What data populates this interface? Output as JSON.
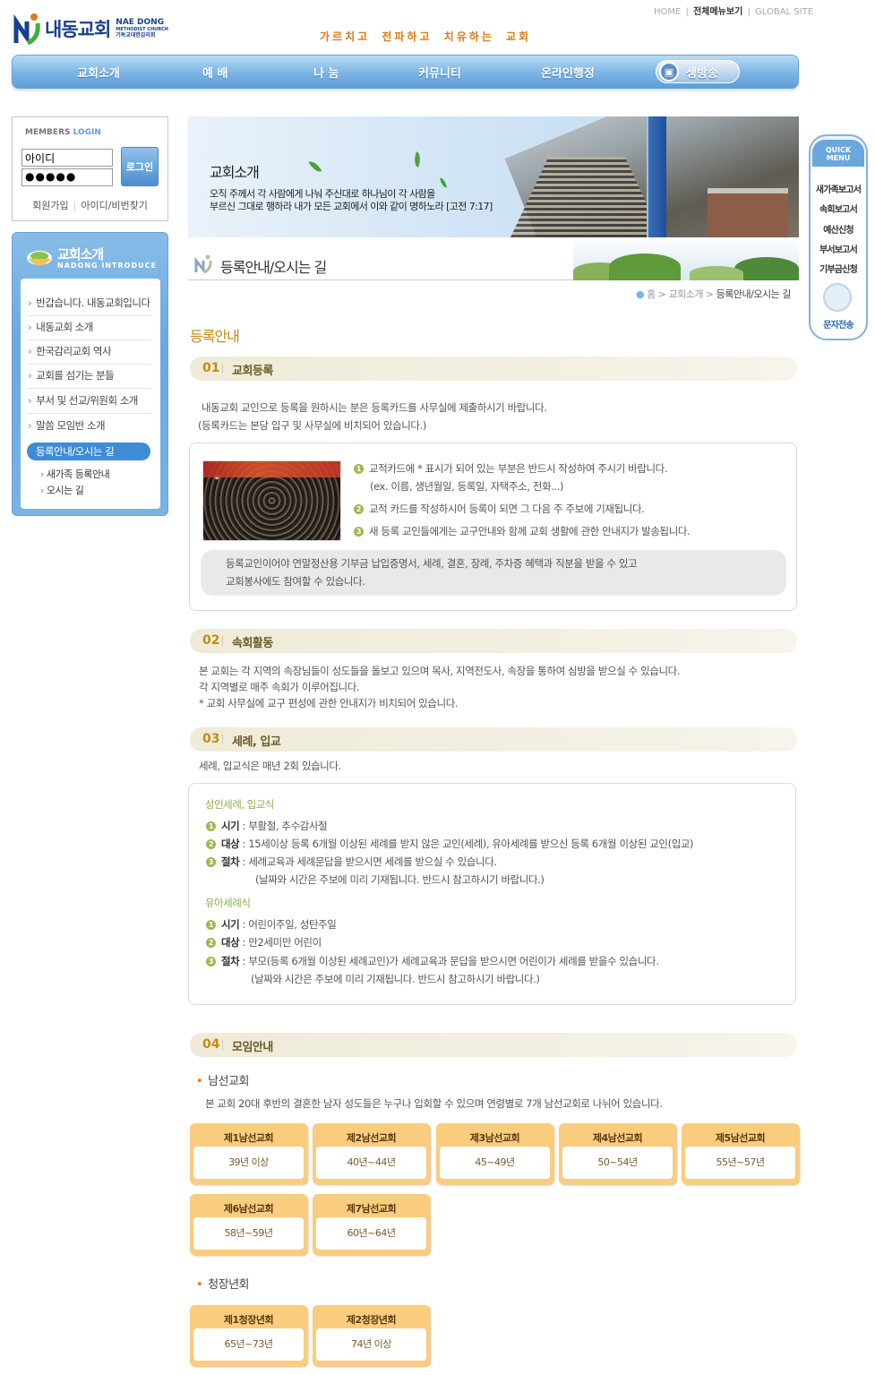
{
  "top_links": {
    "home": "HOME",
    "sitemap": "전체메뉴보기",
    "global": "GLOBAL SITE"
  },
  "logo": {
    "name": "내동교회",
    "sub_en": "NAE DONG",
    "sub_en2": "METHODIST CHURCH",
    "sub_kr": "기독교대한감리회"
  },
  "slogan": "가르치고 전파하고 치유하는 교회",
  "gnb": [
    "교회소개",
    "예 배",
    "나 눔",
    "커뮤니티",
    "온라인행정"
  ],
  "live_label": "생방송",
  "login": {
    "members": "MEMBERS",
    "login_word": "LOGIN",
    "id_value": "아이디",
    "pw_value": "●●●●●",
    "button": "로그인",
    "join": "회원가입",
    "find": "아이디/비번찾기"
  },
  "lnb": {
    "title": "교회소개",
    "subtitle": "NADONG INTRODUCE",
    "items": [
      "반갑습니다. 내동교회입니다",
      "내동교회 소개",
      "한국감리교회 역사",
      "교회를 섬기는 분들",
      "부서 및 선교/위원회 소개",
      "말씀 모임반 소개"
    ],
    "active": "등록안내/오시는 길",
    "sub_items": [
      "새가족 등록안내",
      "오시는 길"
    ]
  },
  "visual": {
    "title": "교회소개",
    "line1": "오직 주께서 각 사람에게 나눠 주신대로 하나님이 각 사람을",
    "line2": "부르신 그대로 행하라 내가 모든 교회에서 이와 같이 명하노라 [고전 7:17]"
  },
  "page_title": "등록안내/오시는 길",
  "location": {
    "home": "홈",
    "parent": "교회소개",
    "current": "등록안내/오시는 길"
  },
  "quick_menu": {
    "head1": "QUICK",
    "head2": "MENU",
    "items": [
      "새가족보고서",
      "속회보고서",
      "예산신청",
      "부서보고서",
      "기부금신청"
    ],
    "sms": "문자전송"
  },
  "content": {
    "heading": "등록안내",
    "sec1": {
      "num": "01",
      "name": "교회등록",
      "intro1": "내동교회 교인으로 등록을 원하시는 분은 등록카드를 사무실에 제출하시기 바랍니다.",
      "intro2": "(등록카드는 본당 입구 및 사무실에 비치되어 있습니다.)",
      "item1": "교적카드에 * 표시가 되어 있는 부분은 반드시 작성하여 주시기 바랍니다.",
      "item1b": "(ex. 이름, 생년월일, 등록일, 자택주소, 전화...)",
      "item2": "교적 카드를 작성하시어 등록이 되면 그 다음 주 주보에 기재됩니다.",
      "item3": "새 등록 교인들에게는 교구안내와 함께 교회 생활에 관한 안내지가 발송됩니다.",
      "note1": "등록교인이어야 연말정산용 기부금 납입증명서, 세례, 결혼, 장례, 주차증 혜택과 직분을 받을 수  있고",
      "note2": "교회봉사에도 참여할 수 있습니다."
    },
    "sec2": {
      "num": "02",
      "name": "속회활동",
      "line1": "본 교회는 각 지역의 속장님들이 성도들을 돌보고 있으며 목사, 지역전도사, 속장을 통하여 심방을 받으실 수 있습니다.",
      "line2": "각 지역별로 매주 속회가 이루어집니다.",
      "line3": "* 교회 사무실에 교구 편성에 관한 안내지가 비치되어 있습니다."
    },
    "sec3": {
      "num": "03",
      "name": "세례, 입교",
      "intro": "세례, 입교식은 매년 2회 있습니다.",
      "adult_title": "성인세례, 입교식",
      "adult": [
        {
          "label": "시기",
          "text": " : 부활절, 추수감사절"
        },
        {
          "label": "대상",
          "text": " : 15세이상 등록 6개월 이상된 세례를 받지 않은 교인(세례), 유아세례를 받으신 등록 6개월 이상된 교인(입교)"
        },
        {
          "label": "절차",
          "text": " : 세례교육과 세례문답을 받으시면 세례를 받으실 수 있습니다."
        }
      ],
      "adult_note": "(날짜와 시간은 주보에 미리 기재됩니다. 반드시 참고하시기 바랍니다.)",
      "infant_title": "유아세례식",
      "infant": [
        {
          "label": "시기",
          "text": " : 어린이주일, 성탄주일"
        },
        {
          "label": "대상",
          "text": " : 만2세미만 어린이"
        },
        {
          "label": "절차",
          "text": " : 부모(등록 6개월 이상된 세례교인)가 세례교육과 문답을 받으시면 어린이가 세례를 받을수 있습니다."
        }
      ],
      "infant_note": "(날짜와 시간은 주보에 미리 기재됩니다. 반드시 참고하시기 바랍니다.)"
    },
    "sec4": {
      "num": "04",
      "name": "모임안내",
      "men_title": "남선교회",
      "men_desc": "본 교회 20대 후반의 결혼한 남자 성도들은 누구나 입회할 수 있으며 연령별로 7개 남선교회로 나뉘어 있습니다.",
      "men": [
        {
          "name": "제1남선교회",
          "age": "39년 이상"
        },
        {
          "name": "제2남선교회",
          "age": "40년~44년"
        },
        {
          "name": "제3남선교회",
          "age": "45~49년"
        },
        {
          "name": "제4남선교회",
          "age": "50~54년"
        },
        {
          "name": "제5남선교회",
          "age": "55년~57년"
        },
        {
          "name": "제6남선교회",
          "age": "58년~59년"
        },
        {
          "name": "제7남선교회",
          "age": "60년~64년"
        }
      ],
      "elder_title": "청장년회",
      "elder": [
        {
          "name": "제1청장년회",
          "age": "65년~73년"
        },
        {
          "name": "제2청장년회",
          "age": "74년 이상"
        }
      ]
    }
  }
}
